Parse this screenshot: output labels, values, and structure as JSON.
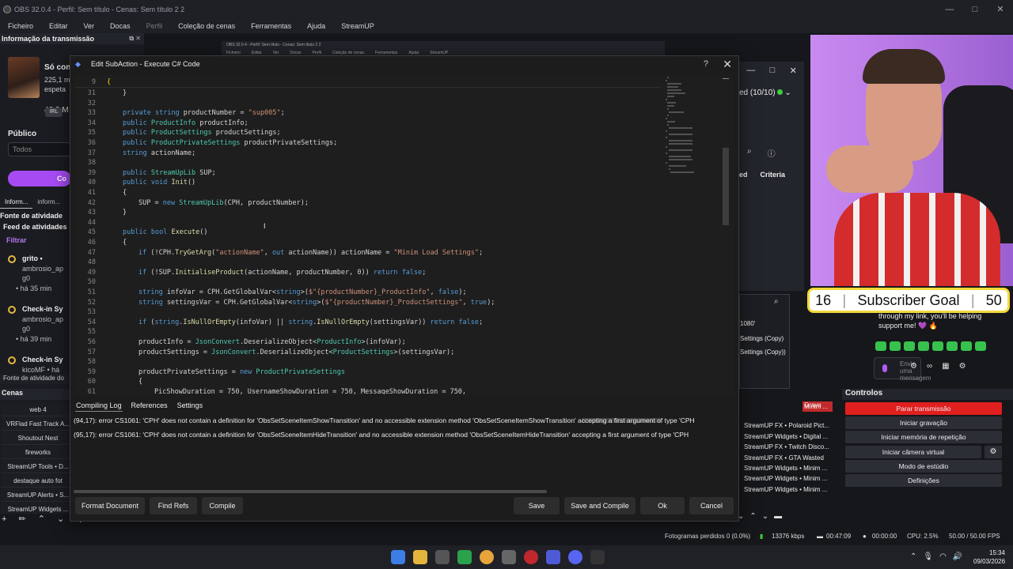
{
  "obs": {
    "title": "OBS 32.0.4 - Perfil: Sem título - Cenas: Sem título 2 2",
    "menu": [
      "Ficheiro",
      "Editar",
      "Ver",
      "Docas",
      "Perfil",
      "Coleção de cenas",
      "Ferramentas",
      "Ajuda",
      "StreamUP"
    ],
    "window_controls": [
      "—",
      "□",
      "✕"
    ]
  },
  "bg_capture": {
    "title": "OBS 32.0.4 - Perfil: Sem título - Cenas: Sem título 2 2",
    "menu": [
      "Ficheiro",
      "Editar",
      "Ver",
      "Docas",
      "Perfil",
      "Coleção de cenas",
      "Ferramentas",
      "Ajuda",
      "StreamUP"
    ]
  },
  "left_dock": {
    "header": "Informação da transmissão",
    "header_buttons": "⧉ ✕",
    "card_title": "Só conversa",
    "card_lines": [
      "225,1 m",
      "espeta",
      "46,3 M"
    ],
    "badge": "IRL",
    "publico_label": "Público",
    "publico_value": "Todos",
    "pill_label": "Co",
    "tabs": [
      "Inform...",
      "inform..."
    ],
    "activity_source": "Fonte de atividade",
    "feed_header": "Feed de atividades",
    "filter": "Filtrar",
    "feed_items": [
      {
        "title": "grito •",
        "sub1": "ambrosio_ap",
        "sub2": "g0",
        "time": "• há 35 min"
      },
      {
        "title": "Check-in Sy",
        "sub1": "ambrosio_ap",
        "sub2": "g0",
        "time": "• há 39 min"
      },
      {
        "title": "Check-in Sy",
        "sub1": "kicoMF • há",
        "sub2": "",
        "time": ""
      }
    ],
    "footer": "Fonte de atividade do",
    "scenes_header": "Cenas",
    "scenes": [
      "web 4",
      "VRFlad Fast Track A...",
      "Shoutout Nest",
      "fireworks",
      "StreamUP Tools • D...",
      "destaque auto fot",
      "StreamUP Alerts • S...",
      "StreamUP Widgets ..."
    ],
    "bottom_tools": "+ ✏ ⌃ ⌄ ⋮"
  },
  "right_docks": {
    "level_text": "ed (10/10)",
    "criteria": [
      "ed",
      "Criteria"
    ],
    "scene_items": [
      "1080'",
      "Settings (Copy)",
      "Settings (Copy))"
    ]
  },
  "webcam": {
    "goal_current": "16",
    "goal_label": "Subscriber Goal",
    "goal_target": "50",
    "chat_message": "through my link, you'll be helping support me! 💜 🔥",
    "chat_placeholder": "Envie uma mensagem"
  },
  "sources_list": {
    "active": "Minim ...",
    "items": [
      "Grave",
      "StreamUP FX • Polaroid Pict...",
      "StreamUP Widgets • Digital ...",
      "StreamUP FX • Twitch Disco...",
      "StreamUP FX • GTA Wasted",
      "StreamUP Widgets • Minim ...",
      "StreamUP Widgets • Minim ...",
      "StreamUP Widgets • Minim ..."
    ]
  },
  "controls": {
    "header": "Controlos",
    "buttons": [
      "Parar transmissão",
      "Iniciar gravação",
      "Iniciar memória de repetição",
      "Iniciar câmera virtual",
      "Modo de estúdio",
      "Definições"
    ]
  },
  "status": {
    "dropped": "Fotogramas perdidos 0 (0.0%)",
    "bitrate": "13376 kbps",
    "live_time": "00:47:09",
    "rec_time": "00:00:00",
    "cpu": "CPU: 2.5%",
    "fps": "50.00 / 50.00 FPS"
  },
  "taskbar": {
    "time": "15:34",
    "date": "09/03/2026"
  },
  "dialog": {
    "title": "Edit SubAction - Execute C# Code",
    "help": "?",
    "close": "✕",
    "sticky_line": "9",
    "code_lines": [
      {
        "n": "31",
        "indent": 2,
        "text": "}"
      },
      {
        "n": "32",
        "indent": 0,
        "text": ""
      },
      {
        "n": "33",
        "indent": 2,
        "text": "private string productNumber = \"sup005\";"
      },
      {
        "n": "34",
        "indent": 2,
        "text": "public ProductInfo productInfo;"
      },
      {
        "n": "35",
        "indent": 2,
        "text": "public ProductSettings productSettings;"
      },
      {
        "n": "36",
        "indent": 2,
        "text": "public ProductPrivateSettings productPrivateSettings;"
      },
      {
        "n": "37",
        "indent": 2,
        "text": "string actionName;"
      },
      {
        "n": "38",
        "indent": 0,
        "text": ""
      },
      {
        "n": "39",
        "indent": 2,
        "text": "public StreamUpLib SUP;"
      },
      {
        "n": "40",
        "indent": 2,
        "text": "public void Init()"
      },
      {
        "n": "41",
        "indent": 2,
        "text": "{"
      },
      {
        "n": "42",
        "indent": 4,
        "text": "SUP = new StreamUpLib(CPH, productNumber);"
      },
      {
        "n": "43",
        "indent": 2,
        "text": "}"
      },
      {
        "n": "44",
        "indent": 0,
        "text": ""
      },
      {
        "n": "45",
        "indent": 2,
        "text": "public bool Execute()"
      },
      {
        "n": "46",
        "indent": 2,
        "text": "{"
      },
      {
        "n": "47",
        "indent": 4,
        "text": "if (!CPH.TryGetArg(\"actionName\", out actionName)) actionName = \"Minim Load Settings\";"
      },
      {
        "n": "48",
        "indent": 0,
        "text": ""
      },
      {
        "n": "49",
        "indent": 4,
        "text": "if (!SUP.InitialiseProduct(actionName, productNumber, 0)) return false;"
      },
      {
        "n": "50",
        "indent": 0,
        "text": ""
      },
      {
        "n": "51",
        "indent": 4,
        "text": "string infoVar = CPH.GetGlobalVar<string>($\"{productNumber}_ProductInfo\", false);"
      },
      {
        "n": "52",
        "indent": 4,
        "text": "string settingsVar = CPH.GetGlobalVar<string>($\"{productNumber}_ProductSettings\", true);"
      },
      {
        "n": "53",
        "indent": 0,
        "text": ""
      },
      {
        "n": "54",
        "indent": 4,
        "text": "if (string.IsNullOrEmpty(infoVar) || string.IsNullOrEmpty(settingsVar)) return false;"
      },
      {
        "n": "55",
        "indent": 0,
        "text": ""
      },
      {
        "n": "56",
        "indent": 4,
        "text": "productInfo = JsonConvert.DeserializeObject<ProductInfo>(infoVar);"
      },
      {
        "n": "57",
        "indent": 4,
        "text": "productSettings = JsonConvert.DeserializeObject<ProductSettings>(settingsVar);"
      },
      {
        "n": "58",
        "indent": 0,
        "text": ""
      },
      {
        "n": "59",
        "indent": 4,
        "text": "productPrivateSettings = new ProductPrivateSettings"
      },
      {
        "n": "60",
        "indent": 4,
        "text": "{"
      },
      {
        "n": "61",
        "indent": 6,
        "text": "PicShowDuration = 750, UsernameShowDuration = 750, MessageShowDuration = 750,"
      }
    ],
    "log_tabs": [
      "Compiling Log",
      "References",
      "Settings"
    ],
    "log_lines": [
      "(94,17): error CS1061: 'CPH' does not contain a definition for 'ObsSetSceneItemShowTransition' and no accessible extension method 'ObsSetSceneItemShowTransition' accepting a first argument of type 'CPH",
      "(95,17): error CS1061: 'CPH' does not contain a definition for 'ObsSetSceneItemHideTransition' and no accessible extension method 'ObsSetSceneItemHideTransition' accepting a first argument of type 'CPH"
    ],
    "buttons": {
      "format": "Format Document",
      "find_refs": "Find Refs",
      "compile": "Compile",
      "save": "Save",
      "save_compile": "Save and Compile",
      "ok": "Ok",
      "cancel": "Cancel"
    }
  }
}
